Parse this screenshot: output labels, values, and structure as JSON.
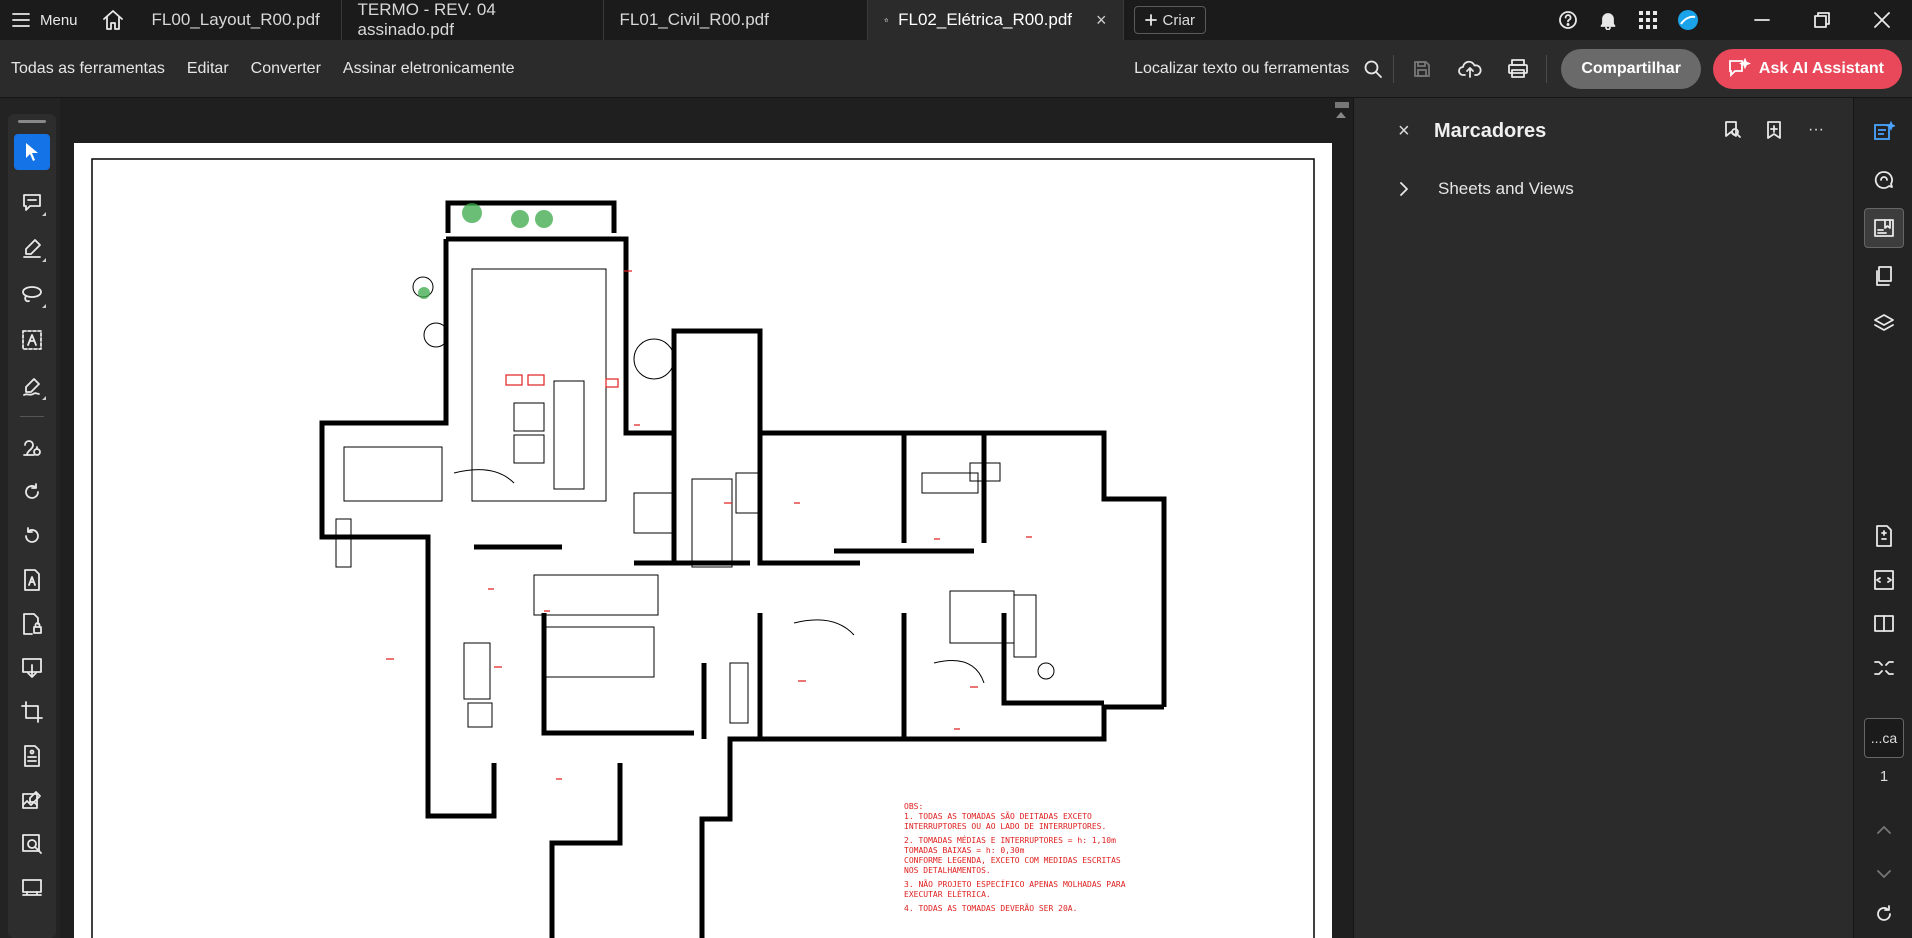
{
  "tabbar": {
    "menu_label": "Menu",
    "tabs": [
      {
        "label": "FL00_Layout_R00.pdf",
        "active": false
      },
      {
        "label": "TERMO - REV. 04 assinado.pdf",
        "active": false
      },
      {
        "label": "FL01_Civil_R00.pdf",
        "active": false
      },
      {
        "label": "FL02_Elétrica_R00.pdf",
        "active": true
      }
    ],
    "close_glyph": "×",
    "create_label": "Criar",
    "icons": [
      "help-icon",
      "bell-icon",
      "apps-grid-icon",
      "profile-avatar-icon"
    ]
  },
  "toolbar": {
    "items": [
      "Todas as ferramentas",
      "Editar",
      "Converter",
      "Assinar eletronicamente"
    ],
    "find_label": "Localizar texto ou ferramentas",
    "share_label": "Compartilhar",
    "ai_label": "Ask AI Assistant",
    "share_color": "#6a6a6a",
    "ai_color": "#e8485a"
  },
  "left_tools": [
    "select-arrow-icon",
    "comment-icon",
    "highlight-pen-icon",
    "lasso-draw-icon",
    "text-box-icon",
    "sign-pen-icon",
    "stamp-icon",
    "rotate-right-icon",
    "rotate-left-icon",
    "edit-pdf-icon",
    "protect-pdf-icon",
    "export-pdf-icon",
    "crop-icon",
    "form-icon",
    "edit-image-icon",
    "search-document-icon",
    "organize-icon"
  ],
  "document": {
    "notes_title": "OBS:",
    "notes": [
      "1. TODAS AS TOMADAS SÃO DEITADAS EXCETO",
      "INTERRUPTORES OU AO LADO DE INTERRUPTORES.",
      "2. TOMADAS MÉDIAS E INTERRUPTORES = h: 1,10m",
      "TOMADAS BAIXAS = h: 0,30m",
      "CONFORME LEGENDA, EXCETO COM MEDIDAS ESCRITAS",
      "NOS DETALHAMENTOS.",
      "3. NÃO PROJETO ESPECÍFICO APENAS MOLHADAS PARA",
      "EXECUTAR ELÉTRICA.",
      "4. TODAS AS TOMADAS DEVERÃO SER 20A."
    ],
    "accent_red": "#e02020",
    "plant_green": "#3aa848"
  },
  "panel": {
    "title": "Marcadores",
    "bookmark": "Sheets and Views",
    "close_glyph": "×",
    "more_glyph": "···"
  },
  "right_rail": {
    "page_field": "...ca",
    "page_number": "1"
  }
}
